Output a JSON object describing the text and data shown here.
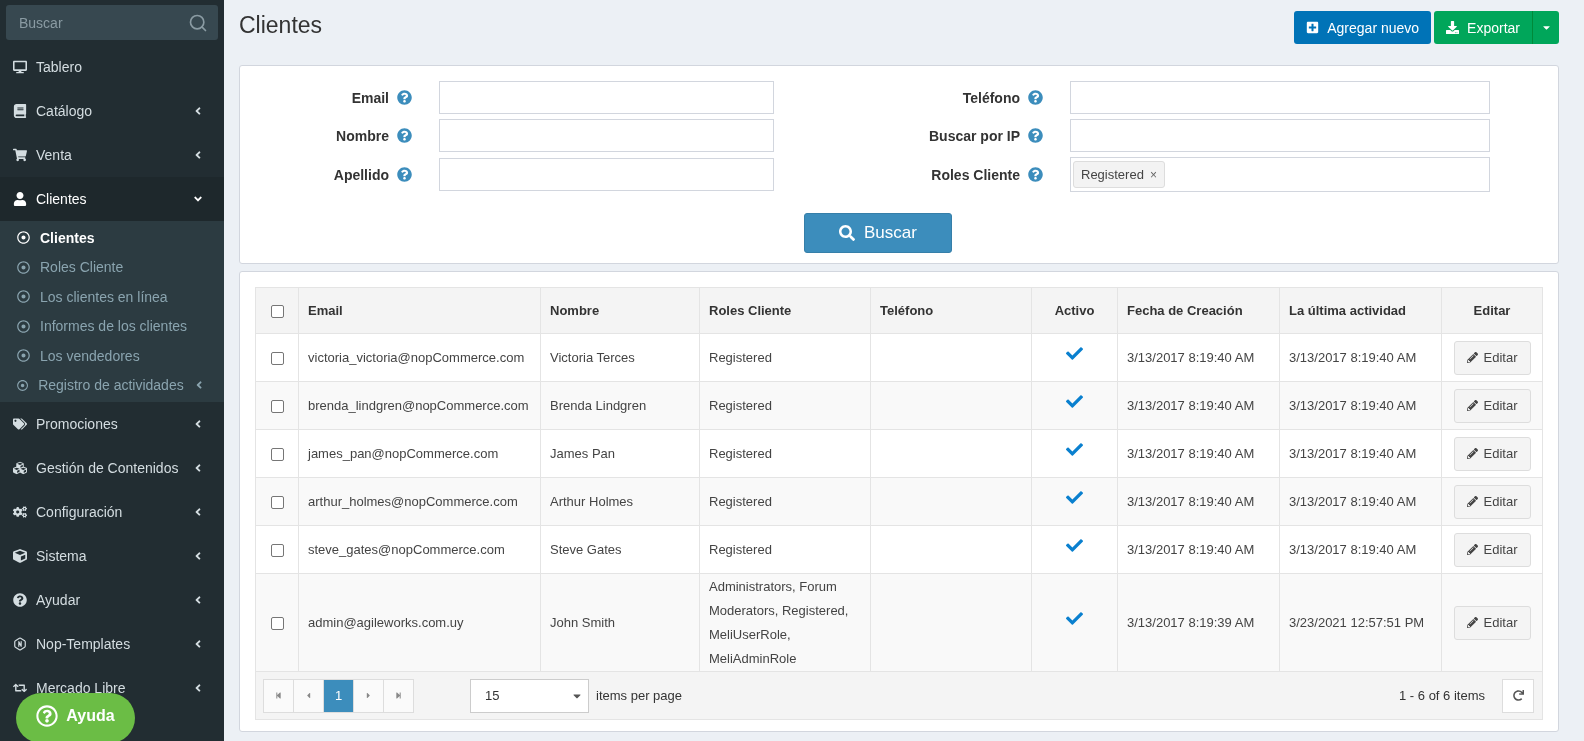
{
  "sidebar": {
    "search_placeholder": "Buscar",
    "items": [
      {
        "label": "Tablero",
        "expandable": false,
        "selected": false
      },
      {
        "label": "Catálogo",
        "expandable": true,
        "expanded": false,
        "selected": false
      },
      {
        "label": "Venta",
        "expandable": true,
        "expanded": false,
        "selected": false
      },
      {
        "label": "Clientes",
        "expandable": true,
        "expanded": true,
        "selected": true,
        "children": [
          {
            "label": "Clientes",
            "selected": true,
            "expandable": false
          },
          {
            "label": "Roles Cliente",
            "selected": false,
            "expandable": false
          },
          {
            "label": "Los clientes en línea",
            "selected": false,
            "expandable": false
          },
          {
            "label": "Informes de los clientes",
            "selected": false,
            "expandable": false
          },
          {
            "label": "Los vendedores",
            "selected": false,
            "expandable": false
          },
          {
            "label": "Registro de actividades",
            "selected": false,
            "expandable": true
          }
        ]
      },
      {
        "label": "Promociones",
        "expandable": true,
        "expanded": false,
        "selected": false
      },
      {
        "label": "Gestión de Contenidos",
        "expandable": true,
        "expanded": false,
        "selected": false
      },
      {
        "label": "Configuración",
        "expandable": true,
        "expanded": false,
        "selected": false
      },
      {
        "label": "Sistema",
        "expandable": true,
        "expanded": false,
        "selected": false
      },
      {
        "label": "Ayudar",
        "expandable": true,
        "expanded": false,
        "selected": false
      },
      {
        "label": "Nop-Templates",
        "expandable": true,
        "expanded": false,
        "selected": false
      },
      {
        "label": "Mercado Libre",
        "expandable": true,
        "expanded": false,
        "selected": false
      }
    ]
  },
  "help_button": "Ayuda",
  "header": {
    "title": "Clientes",
    "add_button": "Agregar nuevo",
    "export_button": "Exportar"
  },
  "filter": {
    "left_fields": [
      {
        "label": "Email"
      },
      {
        "label": "Nombre"
      },
      {
        "label": "Apellido"
      }
    ],
    "right_fields": [
      {
        "label": "Teléfono"
      },
      {
        "label": "Buscar por IP"
      },
      {
        "label": "Roles Cliente",
        "tags": [
          {
            "label": "Registered",
            "remove": "×"
          }
        ]
      }
    ],
    "search_button": "Buscar"
  },
  "table": {
    "all_checked": false,
    "columns": [
      "Email",
      "Nombre",
      "Roles Cliente",
      "Teléfono",
      "Activo",
      "Fecha de Creación",
      "La última actividad",
      "Editar"
    ],
    "rows": [
      {
        "checked": false,
        "email": "victoria_victoria@nopCommerce.com",
        "name": "Victoria Terces",
        "roles": "Registered",
        "active": true,
        "created": "3/13/2017 8:19:40 AM",
        "last_activity": "3/13/2017 8:19:40 AM",
        "edit": "Editar"
      },
      {
        "checked": false,
        "email": "brenda_lindgren@nopCommerce.com",
        "name": "Brenda Lindgren",
        "roles": "Registered",
        "active": true,
        "created": "3/13/2017 8:19:40 AM",
        "last_activity": "3/13/2017 8:19:40 AM",
        "edit": "Editar"
      },
      {
        "checked": false,
        "email": "james_pan@nopCommerce.com",
        "name": "James Pan",
        "roles": "Registered",
        "active": true,
        "created": "3/13/2017 8:19:40 AM",
        "last_activity": "3/13/2017 8:19:40 AM",
        "edit": "Editar"
      },
      {
        "checked": false,
        "email": "arthur_holmes@nopCommerce.com",
        "name": "Arthur Holmes",
        "roles": "Registered",
        "active": true,
        "created": "3/13/2017 8:19:40 AM",
        "last_activity": "3/13/2017 8:19:40 AM",
        "edit": "Editar"
      },
      {
        "checked": false,
        "email": "steve_gates@nopCommerce.com",
        "name": "Steve Gates",
        "roles": "Registered",
        "active": true,
        "created": "3/13/2017 8:19:40 AM",
        "last_activity": "3/13/2017 8:19:40 AM",
        "edit": "Editar"
      },
      {
        "checked": false,
        "email": "admin@agileworks.com.uy",
        "name": "John Smith",
        "roles": "Administrators, Forum Moderators, Registered, MeliUserRole, MeliAdminRole",
        "active": true,
        "created": "3/13/2017 8:19:39 AM",
        "last_activity": "3/23/2021 12:57:51 PM",
        "edit": "Editar"
      }
    ],
    "pager": {
      "pages": [
        {
          "label": "1",
          "selected": true
        }
      ],
      "page_size": "15",
      "per_page_label": "items per page",
      "summary": "1 - 6 of 6 items"
    }
  }
}
